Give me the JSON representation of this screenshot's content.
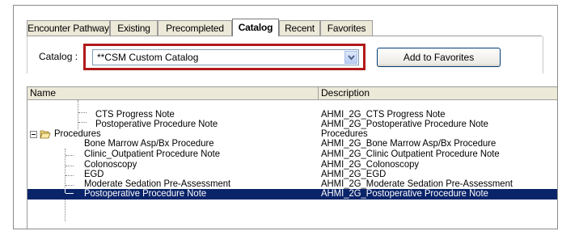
{
  "tabs": [
    {
      "label": "Encounter Pathway"
    },
    {
      "label": "Existing"
    },
    {
      "label": "Precompleted"
    },
    {
      "label": "Catalog"
    },
    {
      "label": "Recent"
    },
    {
      "label": "Favorites"
    }
  ],
  "active_tab": "Catalog",
  "catalog": {
    "label": "Catalog :",
    "selected_value": "**CSM Custom Catalog",
    "add_button": "Add to Favorites"
  },
  "list": {
    "columns": [
      "Name",
      "Description"
    ],
    "rows": [
      {
        "name": "CTS Progress Note",
        "description": "AHMI_2G_CTS Progress Note"
      },
      {
        "name": "Postoperative Procedure Note",
        "description": "AHMI_2G_Postoperative Procedure Note"
      },
      {
        "name": "Procedures",
        "description": "Procedures"
      },
      {
        "name": "Bone Marrow Asp/Bx Procedure",
        "description": "AHMI_2G_Bone Marrow Asp/Bx Procedure"
      },
      {
        "name": "Clinic_Outpatient Procedure Note",
        "description": "AHMI_2G_Clinic Outpatient Procedure Note"
      },
      {
        "name": "Colonoscopy",
        "description": "AHMI_2G_Colonoscopy"
      },
      {
        "name": "EGD",
        "description": "AHMI_2G_EGD"
      },
      {
        "name": "Moderate Sedation Pre-Assessment",
        "description": "AHMI_2G_Moderate Sedation Pre-Assessment"
      },
      {
        "name": "Postoperative Procedure Note",
        "description": "AHMI_2G_Postoperative Procedure Note"
      }
    ],
    "selected_row": "Postoperative Procedure Note"
  },
  "colors": {
    "highlight_box": "#b11a1a",
    "selection": "#0a246a",
    "tab_bg": "#ece9d8"
  }
}
